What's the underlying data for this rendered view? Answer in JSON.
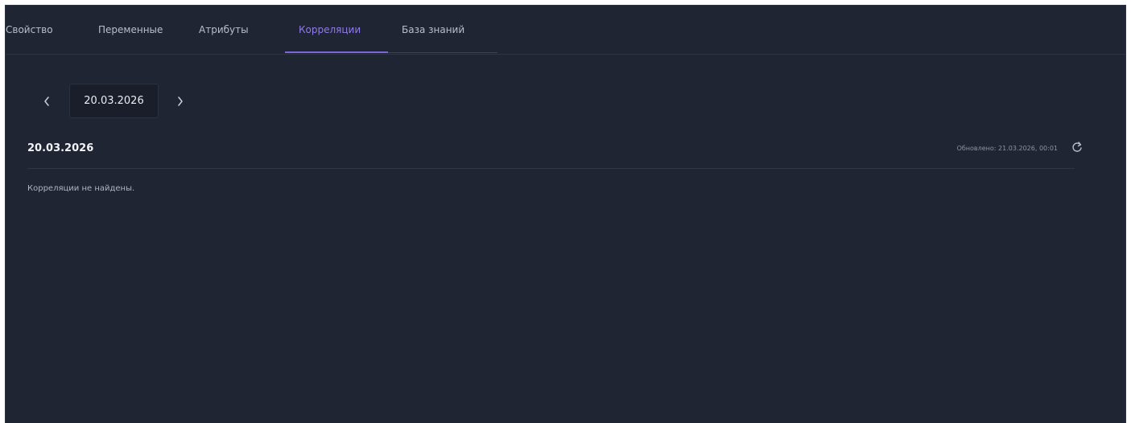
{
  "tabs": [
    {
      "label": "Свойство",
      "active": false
    },
    {
      "label": "Переменные",
      "active": false
    },
    {
      "label": "Атрибуты",
      "active": false
    },
    {
      "label": "Корреляции",
      "active": true
    },
    {
      "label": "База знаний",
      "active": false
    }
  ],
  "date_nav": {
    "prev_icon": "chevron-left-icon",
    "date": "20.03.2026",
    "next_icon": "chevron-right-icon"
  },
  "section": {
    "title": "20.03.2026",
    "updated": "Обновлено: 21.03.2026, 00:01",
    "refresh_icon": "refresh-icon",
    "empty_message": "Корреляции не найдены."
  },
  "colors": {
    "background": "#1f2533",
    "accent": "#7a67d9",
    "active_tab_text": "#8f7ce8"
  }
}
